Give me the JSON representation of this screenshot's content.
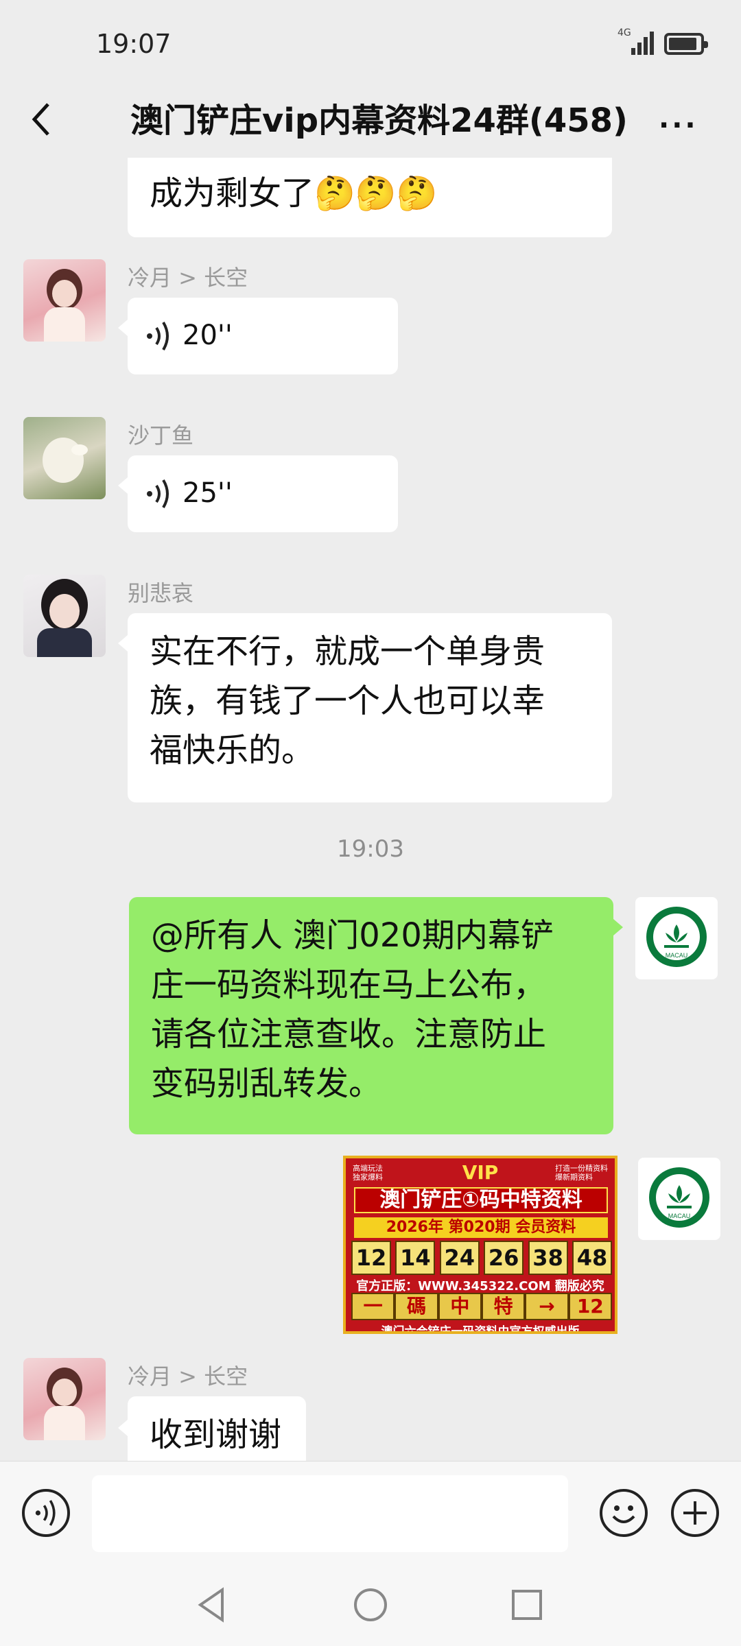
{
  "status": {
    "time": "19:07",
    "network": "4G"
  },
  "header": {
    "title": "澳门铲庄vip内幕资料24群(458)",
    "more_label": "···"
  },
  "messages": [
    {
      "type": "text",
      "side": "left",
      "text_partial": "成为剩女了🤔🤔🤔"
    },
    {
      "type": "voice",
      "side": "left",
      "sender": "冷月 > 长空",
      "duration": "20''"
    },
    {
      "type": "voice",
      "side": "left",
      "sender": "沙丁鱼",
      "duration": "25''"
    },
    {
      "type": "text",
      "side": "left",
      "sender": "别悲哀",
      "lines": [
        "实在不行，就成一个单身贵",
        "族，有钱了一个人也可以幸",
        "福快乐的。"
      ]
    },
    {
      "type": "timestamp",
      "text": "19:03"
    },
    {
      "type": "text",
      "side": "right",
      "lines": [
        "@所有人 澳门020期内幕铲",
        "庄一码资料现在马上公布，",
        "请各位注意查收。注意防止",
        "变码别乱转发。"
      ]
    },
    {
      "type": "image",
      "side": "right"
    },
    {
      "type": "text",
      "side": "left",
      "sender": "冷月 > 长空",
      "text": "收到谢谢"
    }
  ],
  "poster": {
    "vip": "VIP",
    "tag_left": [
      "高端玩法",
      "独家爆料"
    ],
    "tag_right": [
      "打造一份精资料",
      "爆新期资料"
    ],
    "headline": "澳门铲庄①码中特资料",
    "year_line": "2026年 第020期 会员资料",
    "numbers": [
      "12",
      "14",
      "24",
      "26",
      "38",
      "48"
    ],
    "site": "官方正版：WWW.345322.COM 翻版必究",
    "pick": [
      "一",
      "碼",
      "中",
      "特",
      "→",
      "12"
    ],
    "footer": "澳门六合铲庄一码资料由官方权威出版"
  },
  "logo_text": "MACAU",
  "colors": {
    "my_bubble": "#95ec69",
    "background": "#ededed"
  }
}
